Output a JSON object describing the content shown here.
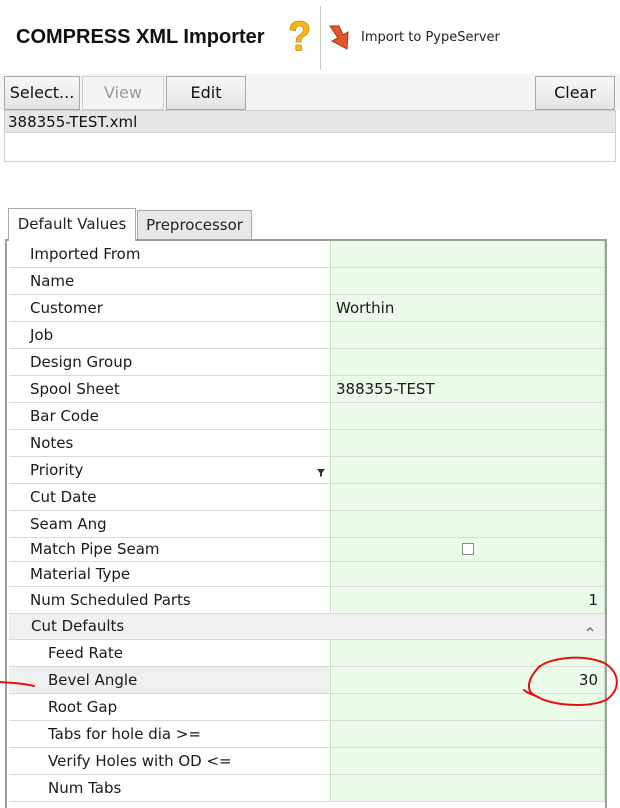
{
  "header": {
    "title": "COMPRESS XML Importer",
    "help_icon": "question-mark-icon",
    "import_label": "Import to PypeServer",
    "import_icon": "arrow-down-icon"
  },
  "toolbar": {
    "select_label": "Select...",
    "view_label": "View",
    "edit_label": "Edit",
    "clear_label": "Clear"
  },
  "files": [
    "388355-TEST.xml"
  ],
  "tabs": {
    "default_values": "Default Values",
    "preprocessor": "Preprocessor",
    "active": "Default Values"
  },
  "properties": [
    {
      "name": "Imported From",
      "value": ""
    },
    {
      "name": "Name",
      "value": ""
    },
    {
      "name": "Customer",
      "value": "Worthin"
    },
    {
      "name": "Job",
      "value": ""
    },
    {
      "name": "Design Group",
      "value": ""
    },
    {
      "name": "Spool Sheet",
      "value": "388355-TEST"
    },
    {
      "name": "Bar Code",
      "value": ""
    },
    {
      "name": "Notes",
      "value": ""
    },
    {
      "name": "Priority",
      "value": ""
    },
    {
      "name": "Cut Date",
      "value": ""
    },
    {
      "name": "Seam Ang",
      "value": ""
    },
    {
      "name": "Match Pipe Seam",
      "value": ""
    },
    {
      "name": "Material Type",
      "value": ""
    },
    {
      "name": "Num Scheduled Parts",
      "value": "1"
    }
  ],
  "category": {
    "name": "Cut Defaults",
    "expanded": true
  },
  "cut_defaults": [
    {
      "name": "Feed Rate",
      "value": ""
    },
    {
      "name": "Bevel Angle",
      "value": "30"
    },
    {
      "name": "Root Gap",
      "value": ""
    },
    {
      "name": "Tabs for hole dia >=",
      "value": ""
    },
    {
      "name": "Verify Holes with OD <=",
      "value": ""
    },
    {
      "name": "Num Tabs",
      "value": ""
    }
  ],
  "colors": {
    "value_cell": "#eafbe8",
    "annotation": "#e81010",
    "accent_orange": "#e8552a",
    "help_yellow": "#f5b914"
  }
}
